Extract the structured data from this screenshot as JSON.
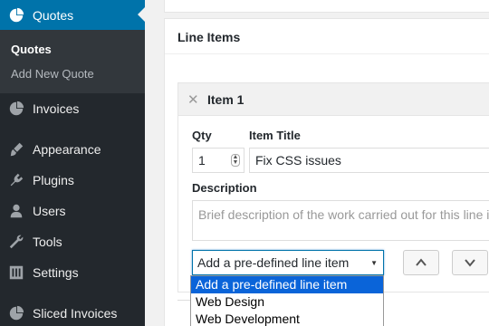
{
  "sidebar": {
    "current": {
      "label": "Quotes",
      "icon": "pie-chart-icon"
    },
    "submenu": [
      {
        "label": "Quotes",
        "active": true
      },
      {
        "label": "Add New Quote",
        "active": false
      }
    ],
    "items": [
      {
        "label": "Invoices",
        "icon": "pie-chart-icon"
      },
      {
        "label": "Appearance",
        "icon": "paint-brush-icon"
      },
      {
        "label": "Plugins",
        "icon": "plugin-icon"
      },
      {
        "label": "Users",
        "icon": "user-icon"
      },
      {
        "label": "Tools",
        "icon": "wrench-icon"
      },
      {
        "label": "Settings",
        "icon": "settings-sliders-icon"
      },
      {
        "label": "Sliced Invoices",
        "icon": "pie-chart-icon"
      }
    ]
  },
  "panel": {
    "title": "Line Items"
  },
  "line_item": {
    "title": "Item 1",
    "qty_label": "Qty",
    "qty_value": "1",
    "item_title_label": "Item Title",
    "item_title_value": "Fix CSS issues",
    "description_label": "Description",
    "description_placeholder": "Brief description of the work carried out for this line item",
    "select_value": "Add a pre-defined line item"
  },
  "dropdown": {
    "options": [
      {
        "label": "Add a pre-defined line item",
        "selected": true
      },
      {
        "label": "Web Design",
        "selected": false
      },
      {
        "label": "Web Development",
        "selected": false
      }
    ]
  },
  "colors": {
    "sidebar_bg": "#23282d",
    "submenu_bg": "#32373c",
    "accent": "#0073aa",
    "selected_option": "#0a64d9"
  }
}
